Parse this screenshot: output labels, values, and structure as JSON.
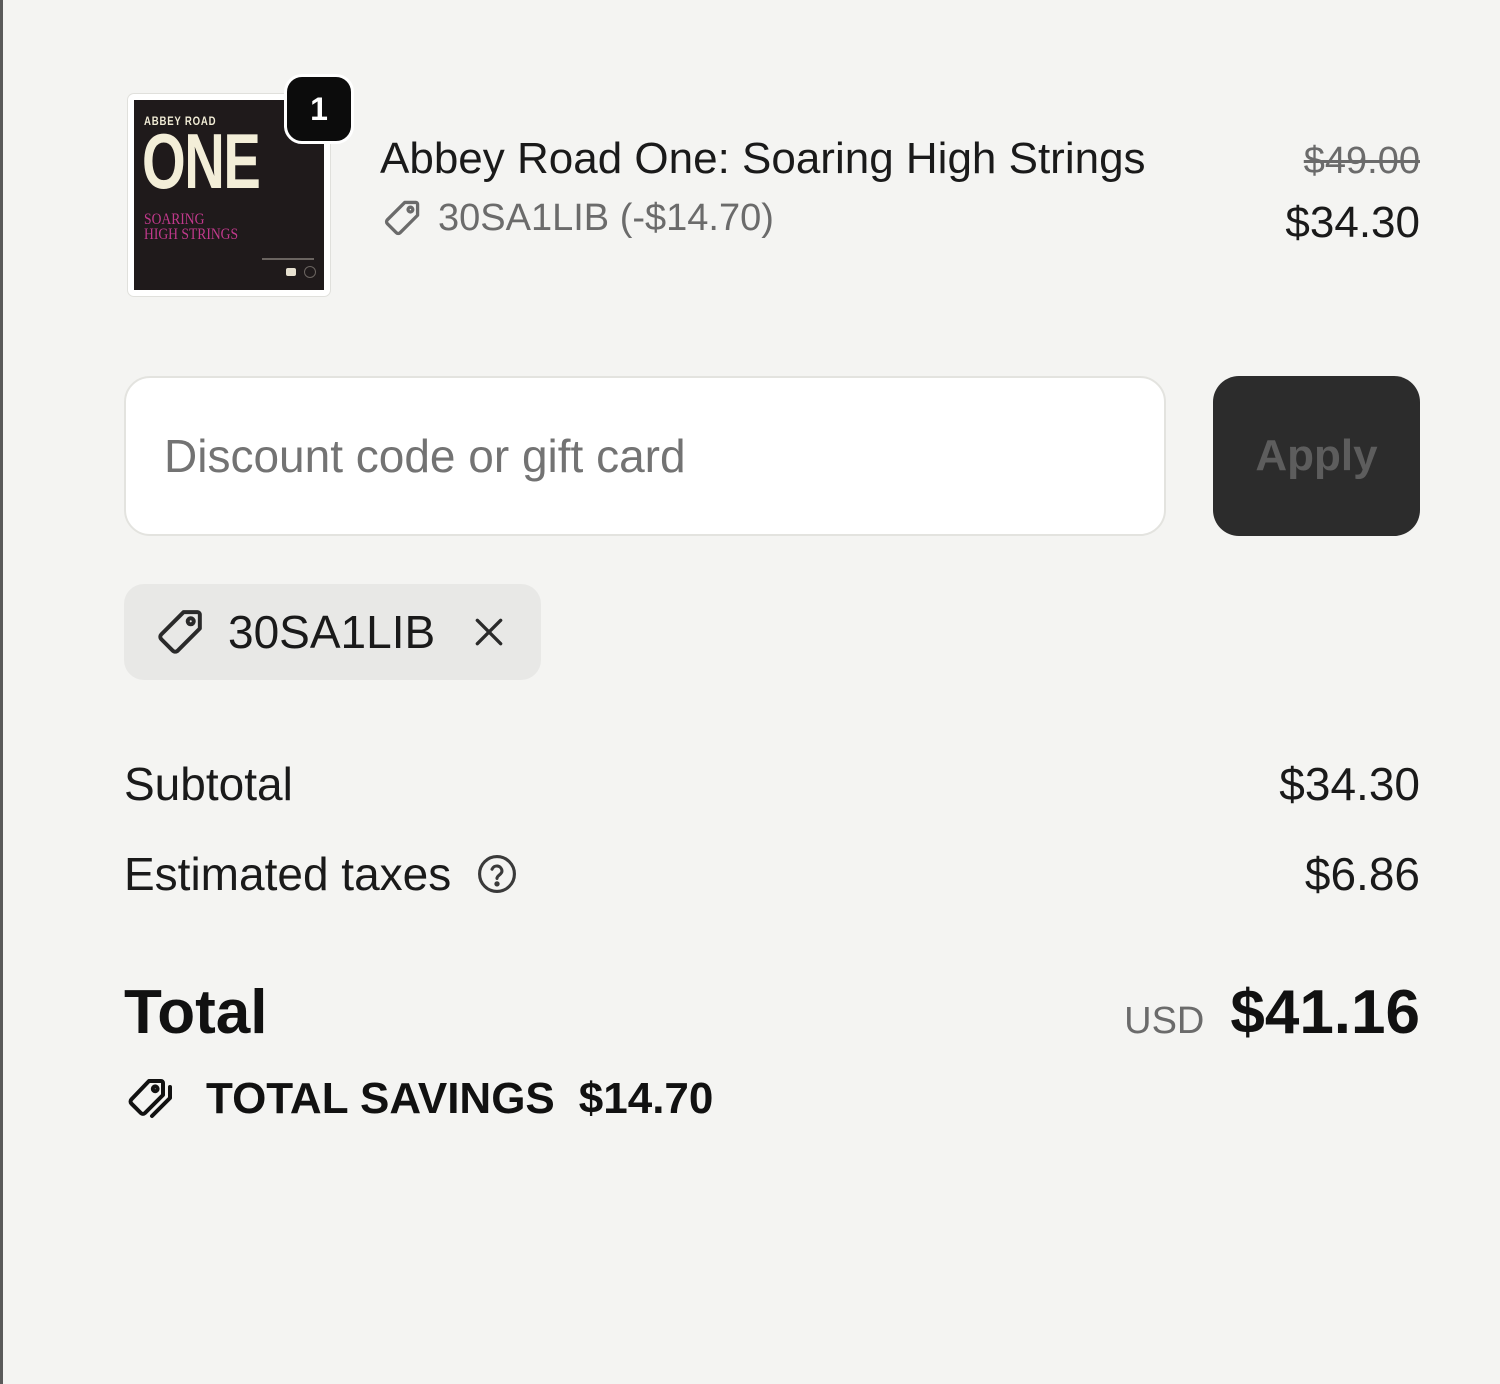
{
  "line_item": {
    "quantity": "1",
    "album_art": {
      "top_text": "ABBEY ROAD",
      "big_text": "ONE",
      "sub_line1": "SOARING",
      "sub_line2": "HIGH STRINGS"
    },
    "title": "Abbey Road One: Soaring High Strings",
    "discount_line": "30SA1LIB (-$14.70)",
    "original_price": "$49.00",
    "price": "$34.30"
  },
  "discount_form": {
    "placeholder": "Discount code or gift card",
    "value": "",
    "apply_label": "Apply"
  },
  "applied_code": {
    "label": "30SA1LIB",
    "icon": "tag-icon",
    "remove_icon": "close-icon"
  },
  "summary": {
    "subtotal_label": "Subtotal",
    "subtotal_value": "$34.30",
    "taxes_label": "Estimated taxes",
    "taxes_value": "$6.86",
    "total_label": "Total",
    "currency": "USD",
    "total_value": "$41.16",
    "savings_label": "TOTAL SAVINGS",
    "savings_value": "$14.70"
  },
  "colors": {
    "background": "#f4f4f2",
    "apply_button": "#2c2c2c",
    "chip_background": "#e8e8e6",
    "album_accent": "#c2398c"
  }
}
